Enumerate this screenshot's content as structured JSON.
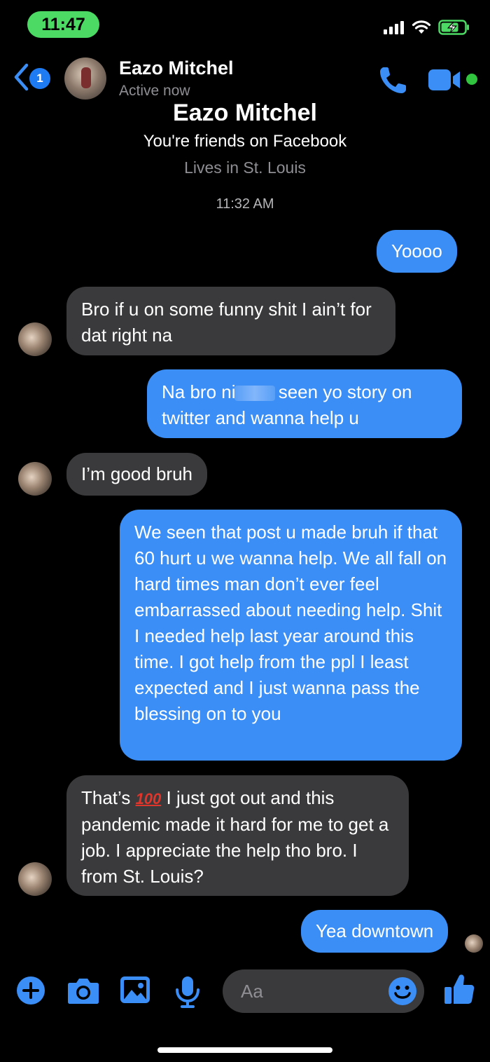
{
  "status_bar": {
    "time": "11:47"
  },
  "header": {
    "back_badge": "1",
    "contact_name": "Eazo Mitchel",
    "contact_status": "Active now"
  },
  "intro": {
    "name": "Eazo Mitchel",
    "friends_text": "You're friends on Facebook",
    "lives_text": "Lives in St. Louis"
  },
  "timestamp": "11:32 AM",
  "messages": [
    {
      "side": "outgoing",
      "text": "Yoooo"
    },
    {
      "side": "incoming",
      "text": "Bro if u on some funny shit I ain’t for dat right na"
    },
    {
      "side": "outgoing",
      "text_before": "Na bro ni",
      "text_after": " seen yo story on twitter and wanna help u"
    },
    {
      "side": "incoming",
      "text": "I’m good bruh"
    },
    {
      "side": "outgoing",
      "text": "We seen that post u made bruh if that 60 hurt u we wanna help. We all fall on hard times man don’t ever feel embarrassed about needing help. Shit I needed help last year around this time. I got help from the ppl I least expected and I just wanna pass the blessing on to you"
    },
    {
      "side": "incoming",
      "text_before": "That’s ",
      "emoji": "100",
      "text_after": " I just got out and this pandemic made it hard for me to get a job. I appreciate the help tho bro. I from St. Louis?"
    },
    {
      "side": "outgoing",
      "text": "Yea downtown"
    }
  ],
  "composer": {
    "placeholder": "Aa"
  },
  "colors": {
    "accent": "#3a8ef6",
    "incoming_bubble": "#3a3a3c",
    "online": "#31c43f",
    "time_pill": "#4cd964"
  }
}
